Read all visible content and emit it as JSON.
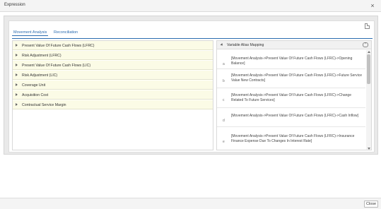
{
  "window": {
    "title": "Expression",
    "close_glyph": "×"
  },
  "panel": {
    "export_icon": "document-icon"
  },
  "tabs": [
    {
      "label": "Movement Analysis",
      "active": true
    },
    {
      "label": "Reconciliation",
      "active": false
    }
  ],
  "left_tree": {
    "items": [
      {
        "label": "Present Value Of Future Cash Flows (LFRC)"
      },
      {
        "label": "Risk Adjustment (LFRC)"
      },
      {
        "label": "Present Value Of Future Cash Flows (LIC)"
      },
      {
        "label": "Risk Adjustment (LIC)"
      },
      {
        "label": "Coverage Unit"
      },
      {
        "label": "Acquisition Cost"
      },
      {
        "label": "Contractual Service Margin"
      }
    ]
  },
  "variable_alias": {
    "header": "Variable Alias Mapping",
    "header_icon": "collapse-icon",
    "items": [
      {
        "alias": "a",
        "text": "[Movement Analysis->Present Value Of Future Cash Flows (LFRC)->Opening Balance]"
      },
      {
        "alias": "b",
        "text": "[Movement Analysis->Present Value Of Future Cash Flows (LFRC)->Future Service Value New Contracts]"
      },
      {
        "alias": "c",
        "text": "[Movement Analysis->Present Value Of Future Cash Flows (LFRC)->Change Related To Future Services]"
      },
      {
        "alias": "d",
        "text": "[Movement Analysis->Present Value Of Future Cash Flows (LFRC)->Cash Inflow]"
      },
      {
        "alias": "e",
        "text": "[Movement Analysis->Present Value Of Future Cash Flows (LFRC)->Insurance Finance Expense Due To Changes In Interest Rate]"
      }
    ]
  },
  "footer": {
    "close_label": "Close"
  }
}
